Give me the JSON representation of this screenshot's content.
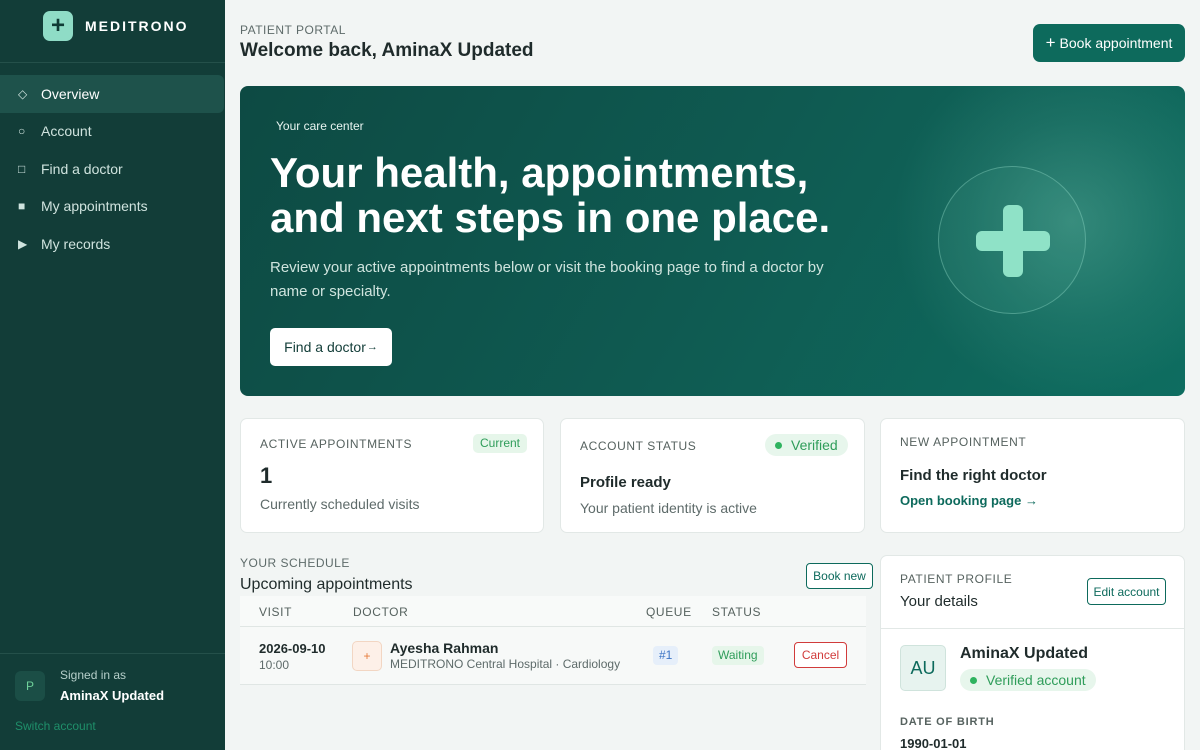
{
  "brand": {
    "name": "MEDITRONO",
    "logo_glyph": "+"
  },
  "sidebar": {
    "items": [
      {
        "label": "Overview",
        "icon": "diamond-icon",
        "glyph": "◇",
        "active": true
      },
      {
        "label": "Account",
        "icon": "circle-icon",
        "glyph": "○",
        "active": false
      },
      {
        "label": "Find a doctor",
        "icon": "square-icon",
        "glyph": "□",
        "active": false
      },
      {
        "label": "My appointments",
        "icon": "filled-square-icon",
        "glyph": "■",
        "active": false
      },
      {
        "label": "My records",
        "icon": "play-icon",
        "glyph": "▶",
        "active": false
      }
    ],
    "signed_in_label": "Signed in as",
    "signed_in_name": "AminaX Updated",
    "signed_in_initial": "P",
    "switch_account": "Switch account"
  },
  "header": {
    "eyebrow": "PATIENT PORTAL",
    "title": "Welcome back, AminaX Updated",
    "book_button": "Book appointment",
    "book_button_glyph": "+"
  },
  "hero": {
    "tag": "Your care center",
    "title": "Your health, appointments, and next steps in one place.",
    "description": "Review your active appointments below or visit the booking page to find a doctor by name or specialty.",
    "button": "Find a doctor",
    "button_arrow": "→"
  },
  "cards": {
    "active": {
      "label": "ACTIVE APPOINTMENTS",
      "badge": "Current",
      "count": "1",
      "sub": "Currently scheduled visits"
    },
    "account": {
      "label": "ACCOUNT STATUS",
      "badge": "Verified",
      "title": "Profile ready",
      "sub": "Your patient identity is active"
    },
    "new": {
      "label": "NEW APPOINTMENT",
      "title": "Find the right doctor",
      "link": "Open booking page →"
    }
  },
  "schedule": {
    "eyebrow": "YOUR SCHEDULE",
    "title": "Upcoming appointments",
    "book_new": "Book new",
    "columns": [
      "VISIT",
      "DOCTOR",
      "QUEUE",
      "STATUS"
    ],
    "rows": [
      {
        "date": "2026-09-10",
        "time": "10:00",
        "doctor_initial": "+",
        "doctor_name": "Ayesha Rahman",
        "doctor_place": "MEDITRONO Central Hospital · Cardiology",
        "queue": "#1",
        "status": "Waiting",
        "action": "Cancel"
      }
    ]
  },
  "profile": {
    "eyebrow": "PATIENT PROFILE",
    "title": "Your details",
    "edit_button": "Edit account",
    "initials": "AU",
    "name": "AminaX Updated",
    "status": "Verified account",
    "dob_label": "DATE OF BIRTH",
    "dob_value": "1990-01-01"
  },
  "colors": {
    "sidebar_bg": "#123d38",
    "accent": "#0d6a5c",
    "success": "#2f9d5a",
    "danger": "#d13b3b",
    "info": "#3b74c4"
  }
}
